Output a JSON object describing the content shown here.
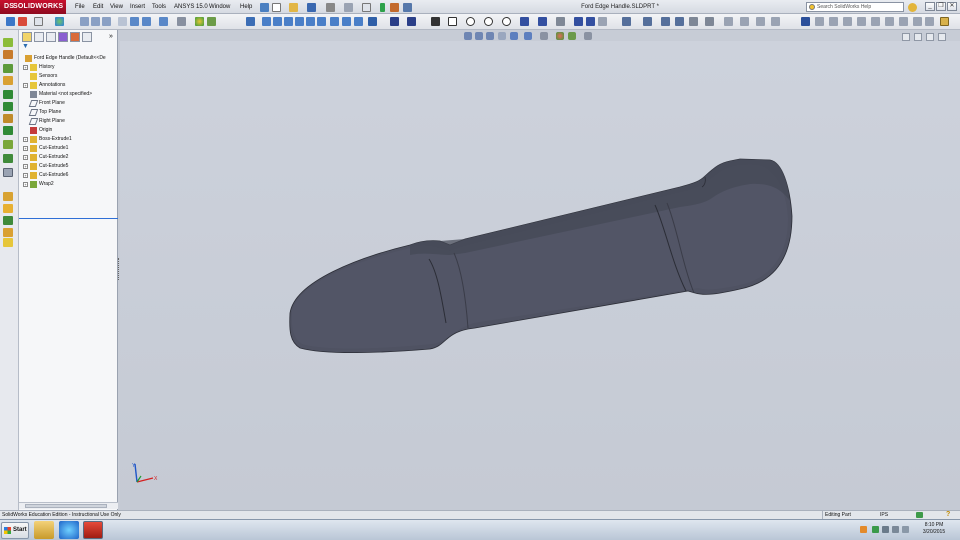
{
  "app": {
    "brand": "SOLIDWORKS",
    "brand_mark": "DS",
    "document_title": "Ford Edge Handle.SLDPRT *"
  },
  "menu": [
    "File",
    "Edit",
    "View",
    "Insert",
    "Tools",
    "ANSYS 15.0",
    "Window",
    "Help"
  ],
  "search": {
    "placeholder": "Search SolidWorks Help"
  },
  "window_controls": {
    "minimize": "_",
    "restore": "❐",
    "close": "✕"
  },
  "feature_tree": {
    "items": [
      {
        "label": "Ford Edge Handle  (Default<<De",
        "expander": "",
        "icon": "part-icon"
      },
      {
        "label": "History",
        "expander": "+",
        "icon": "history-folder-icon"
      },
      {
        "label": "Sensors",
        "expander": "",
        "icon": "sensors-folder-icon"
      },
      {
        "label": "Annotations",
        "expander": "+",
        "icon": "annotations-icon"
      },
      {
        "label": "Material <not specified>",
        "expander": "",
        "icon": "material-icon"
      },
      {
        "label": "Front Plane",
        "expander": "",
        "icon": "plane-icon"
      },
      {
        "label": "Top Plane",
        "expander": "",
        "icon": "plane-icon"
      },
      {
        "label": "Right Plane",
        "expander": "",
        "icon": "plane-icon"
      },
      {
        "label": "Origin",
        "expander": "",
        "icon": "origin-icon"
      },
      {
        "label": "Boss-Extrude1",
        "expander": "+",
        "icon": "boss-extrude-icon"
      },
      {
        "label": "Cut-Extrude1",
        "expander": "+",
        "icon": "cut-extrude-icon"
      },
      {
        "label": "Cut-Extrude2",
        "expander": "+",
        "icon": "cut-extrude-icon"
      },
      {
        "label": "Cut-Extrude5",
        "expander": "+",
        "icon": "cut-extrude-icon"
      },
      {
        "label": "Cut-Extrude6",
        "expander": "+",
        "icon": "cut-extrude-icon"
      },
      {
        "label": "Wrap2",
        "expander": "+",
        "icon": "wrap-icon"
      }
    ]
  },
  "triad": {
    "x_label": "X",
    "y_label": "Y"
  },
  "statusbar": {
    "left": "SolidWorks Education Edition - Instructional Use Only",
    "mode": "Editing Part",
    "units": "IPS",
    "help": "?"
  },
  "taskbar": {
    "start_label": "Start",
    "time": "8:10 PM",
    "date": "3/20/2015"
  },
  "colors": {
    "brand_red": "#c8102e",
    "viewport_bg": "#c7ccd6",
    "model_body": "#4e5160",
    "model_edge": "#2b2d36"
  }
}
